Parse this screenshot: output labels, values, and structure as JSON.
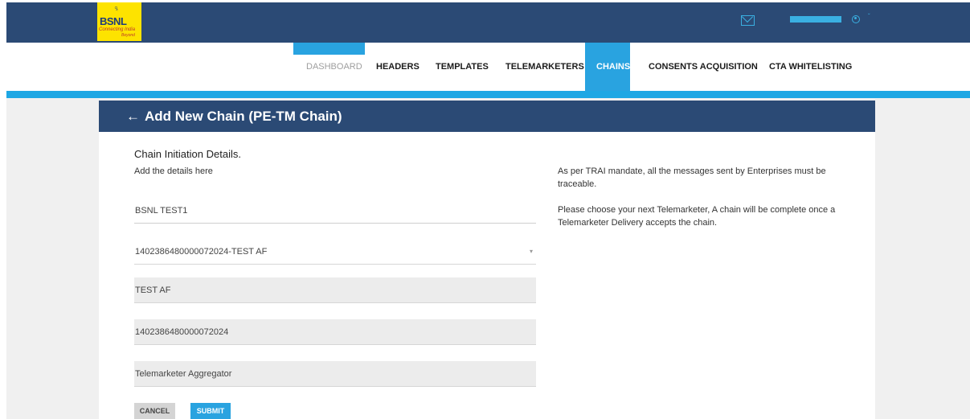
{
  "topbar": {
    "logo": {
      "mark": "♀",
      "name": "BSNL",
      "tagline": "Connecting India",
      "tagline2": "Beyond"
    },
    "user_name": "",
    "icons": {
      "mail": "mail-icon",
      "user": "user-circle-icon",
      "chevron": "chevron-down-icon"
    },
    "user_chevron": "ˇ"
  },
  "nav": {
    "items": [
      {
        "label": "DASHBOARD"
      },
      {
        "label": "HEADERS"
      },
      {
        "label": "TEMPLATES"
      },
      {
        "label": "TELEMARKETERS"
      },
      {
        "label": "CHAINS"
      },
      {
        "label": "CONSENTS ACQUISITION"
      },
      {
        "label": "CTA WHITELISTING"
      }
    ],
    "active": "CHAINS"
  },
  "page": {
    "back_icon": "←",
    "title": "Add New Chain (PE-TM Chain)"
  },
  "form": {
    "section_title": "Chain Initiation Details.",
    "section_subtitle": "Add the details here",
    "fields": [
      {
        "value": "BSNL TEST1"
      },
      {
        "value": "1402386480000072024-TEST AF",
        "caret": "▾"
      },
      {
        "value": "TEST AF"
      },
      {
        "value": "1402386480000072024"
      },
      {
        "value": "Telemarketer Aggregator"
      }
    ],
    "cancel_label": "CANCEL",
    "submit_label": "SUBMIT"
  },
  "info": {
    "line1": "As per TRAI mandate, all the messages sent by Enterprises must be traceable.",
    "line2": "Please choose your next Telemarketer, A chain will be complete once a Telemarketer Delivery accepts the chain."
  },
  "colors": {
    "navy": "#2b4a75",
    "accent": "#29a3e0",
    "logo_yellow": "#fde300"
  }
}
